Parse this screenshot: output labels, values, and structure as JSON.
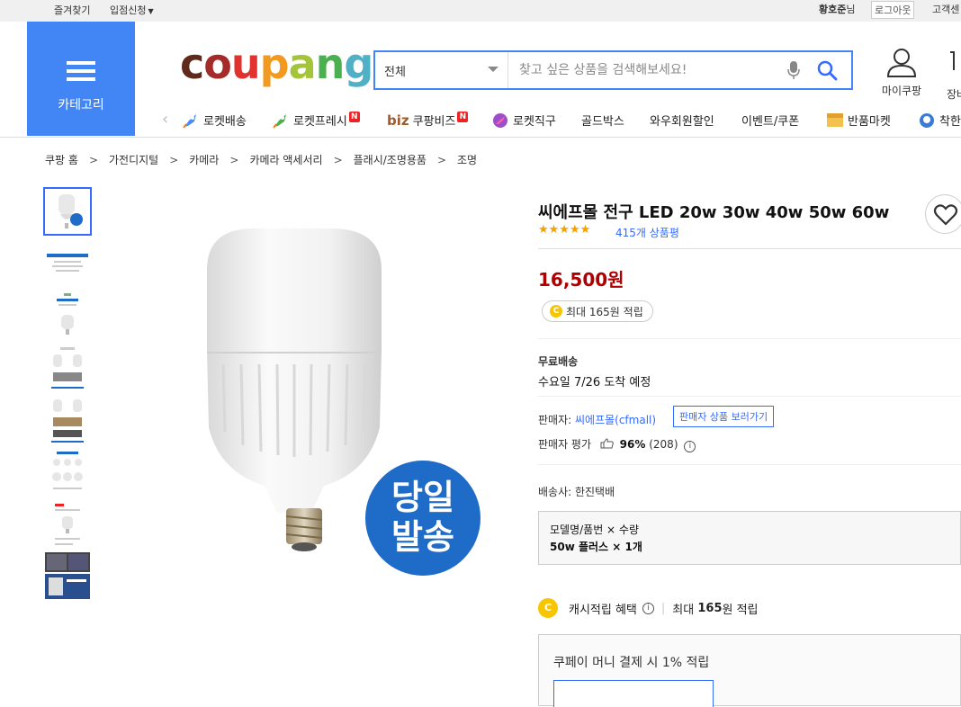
{
  "topbar": {
    "favorites": "즐겨찾기",
    "seller_signup": "입점신청",
    "user_name": "황호준",
    "user_suffix": "님",
    "logout": "로그아웃",
    "customer_center": "고객센"
  },
  "header": {
    "category_label": "카테고리",
    "logo": [
      "c",
      "o",
      "u",
      "p",
      "a",
      "n",
      "g"
    ],
    "search_category": "전체",
    "search_placeholder": "찾고 싶은 상품을 검색해보세요!",
    "mycoupang": "마이쿠팡",
    "cart": "장바"
  },
  "nav": {
    "items": [
      {
        "label": "로켓배송",
        "icon": "rocket-icon",
        "color": "#4a8df6"
      },
      {
        "label": "로켓프레시",
        "icon": "rocket-fresh-icon",
        "color": "#4caf50",
        "badge": "N"
      },
      {
        "label": "쿠팡비즈",
        "icon": "biz-icon",
        "prefix": "biz",
        "badge": "N"
      },
      {
        "label": "로켓직구",
        "icon": "global-rocket-icon",
        "color": "#9c4dcc"
      },
      {
        "label": "골드박스"
      },
      {
        "label": "와우회원할인"
      },
      {
        "label": "이벤트/쿠폰"
      },
      {
        "label": "반품마켓",
        "icon": "return-market-icon",
        "color": "#e0a030"
      },
      {
        "label": "착한",
        "icon": "good-icon",
        "color": "#3a7bd5"
      }
    ]
  },
  "breadcrumb": [
    "쿠팡 홈",
    "가전디지털",
    "카메라",
    "카메라 액세서리",
    "플래시/조명용품",
    "조명"
  ],
  "breadcrumb_sep": ">",
  "product": {
    "title": "씨에프몰 전구 LED 20w 30w 40w 50w 60w",
    "rating": 5,
    "stars": "★★★★★",
    "review_count": "415개 상품평",
    "price": "16,500원",
    "reward": "최대 165원 적립",
    "coin_symbol": "C",
    "shipping_type": "무료배송",
    "delivery": "수요일 7/26 도착 예정",
    "seller_label": "판매자: ",
    "seller_name": "씨에프몰(cfmall)",
    "seller_button": "판매자 상품 보러가기",
    "seller_rating_label": "판매자 평가",
    "seller_rating_pct": "96%",
    "seller_rating_count": "(208)",
    "carrier": "배송사: 한진택배",
    "option_header": "모델명/품번 × 수량",
    "option_value": "50w 플러스 × 1개",
    "cash_label": "캐시적립 혜택",
    "cash_max_prefix": "최대",
    "cash_amount": "165",
    "cash_max_suffix": "원 적립",
    "pay_text": "쿠페이 머니 결제 시 1% 적립",
    "badge_line1": "당일",
    "badge_line2": "발송"
  },
  "colors": {
    "accent_blue": "#4285f4",
    "link_blue": "#346aff",
    "price_red": "#ae0000",
    "star": "#f5a000",
    "badge_blue": "#1f6bc8"
  }
}
